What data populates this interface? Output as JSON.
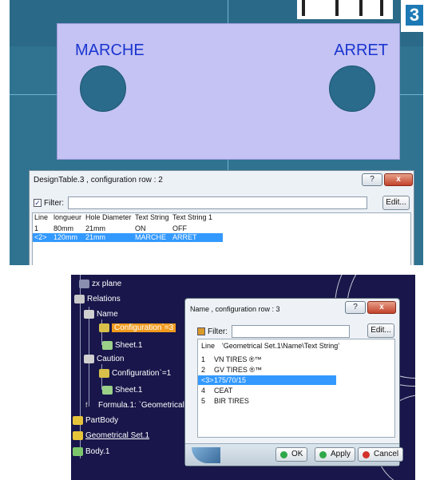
{
  "top": {
    "plate": {
      "left_label": "MARCHE",
      "right_label": "ARRET"
    },
    "dialog": {
      "title": "DesignTable.3 , configuration row : 2",
      "help_button": "?",
      "close_button": "x",
      "filter_label": "Filter:",
      "filter_value": "",
      "filter_checked": true,
      "edit_button": "Edit...",
      "columns": [
        "Line",
        "longueur",
        "Hole Diameter",
        "Text String",
        "Text String 1"
      ],
      "rows": [
        {
          "cells": [
            "1",
            "80mm",
            "21mm",
            "ON",
            "OFF"
          ],
          "selected": false
        },
        {
          "cells": [
            "<2>",
            "120mm",
            "21mm",
            "MARCHE",
            "ARRET"
          ],
          "selected": true
        }
      ]
    }
  },
  "bottom": {
    "tree": {
      "zx_plane": "zx plane",
      "relations": "Relations",
      "name": "Name",
      "configuration_active": "Configuration`=3",
      "sheet_1a": "Sheet.1",
      "caution": "Caution",
      "configuration_2": "Configuration`=1",
      "sheet_1b": "Sheet.1",
      "formula": "Formula.1: `Geometrical",
      "partbody": "PartBody",
      "geoset": "Geometrical Set.1",
      "body": "Body.1"
    },
    "dialog": {
      "title": "Name , configuration row : 3",
      "help_button": "?",
      "close_button": "x",
      "filter_label": "Filter:",
      "filter_value": "",
      "edit_button": "Edit...",
      "columns": [
        "Line",
        "'Geometrical Set.1\\Name\\Text String'"
      ],
      "rows": [
        {
          "cells": [
            "1",
            "VN TIRES ®™"
          ],
          "selected": false
        },
        {
          "cells": [
            "2",
            "GV TIRES ®™"
          ],
          "selected": false
        },
        {
          "cells": [
            "<3>",
            "175/70/15"
          ],
          "selected": true
        },
        {
          "cells": [
            "4",
            "CEAT"
          ],
          "selected": false
        },
        {
          "cells": [
            "5",
            "BIR TIRES"
          ],
          "selected": false
        }
      ],
      "ok_button": "OK",
      "apply_button": "Apply",
      "cancel_button": "Cancel"
    }
  },
  "colors": {
    "selection": "#3399ff",
    "highlight": "#f09a1e",
    "plate": "#c4c3f4",
    "label_blue": "#1b35cf"
  }
}
